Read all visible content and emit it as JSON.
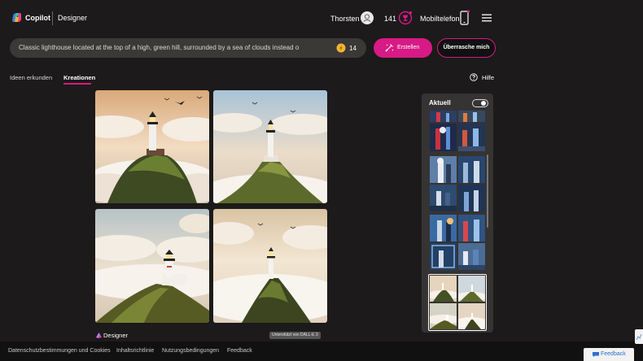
{
  "header": {
    "brand": "Copilot",
    "product": "Designer",
    "user_name": "Thorsten",
    "boost_count": "141",
    "mobile_label": "Mobiltelefon"
  },
  "prompt": {
    "text": "Classic lighthouse located at the top of a high, green hill, surrounded by a sea of clouds instead o",
    "coin_count": "14",
    "create_label": "Erstellen",
    "surprise_label": "Überrasche mich"
  },
  "tabs": [
    {
      "label": "Ideen erkunden",
      "active": false
    },
    {
      "label": "Kreationen",
      "active": true
    }
  ],
  "help_label": "Hilfe",
  "images": [
    {
      "alt": "lighthouse-1"
    },
    {
      "alt": "lighthouse-2"
    },
    {
      "alt": "lighthouse-3"
    },
    {
      "alt": "lighthouse-4"
    }
  ],
  "attribution": {
    "designer_label": "Designer",
    "dalle_badge": "Unterstützt von DALL·E 3"
  },
  "panel": {
    "title": "Aktuell",
    "toggle_on": true
  },
  "footer": {
    "links": [
      "Datenschutzbestimmungen und Cookies",
      "Inhaltsrichtlinie",
      "Nutzungsbedingungen",
      "Feedback"
    ],
    "feedback_button": "Feedback"
  },
  "colors": {
    "accent": "#d71a86",
    "background": "#1c1a1a",
    "panel": "#363333"
  }
}
